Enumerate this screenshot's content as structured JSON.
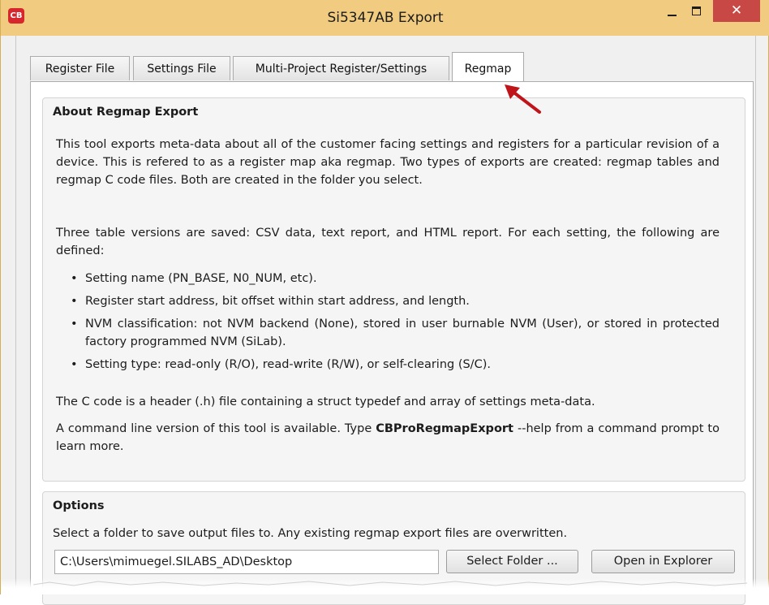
{
  "window": {
    "app_icon_text": "CB",
    "title": "Si5347AB Export",
    "minimize_glyph": "–",
    "maximize_glyph": "□",
    "close_glyph": "✕"
  },
  "tabs": [
    {
      "label": "Register File",
      "active": false
    },
    {
      "label": "Settings File",
      "active": false
    },
    {
      "label": "Multi-Project Register/Settings",
      "active": false
    },
    {
      "label": "Regmap",
      "active": true
    }
  ],
  "about": {
    "title": "About Regmap Export",
    "intro": "This tool exports meta-data about all of the customer facing settings and registers for a particular revision of a device. This is refered to as a register map aka regmap. Two types of exports are created: regmap tables and regmap C code files. Both are created in the folder you select.",
    "tables_intro": "Three table versions are saved: CSV data, text report, and HTML report. For each setting, the following are defined:",
    "bullets": [
      "Setting name (PN_BASE, N0_NUM, etc).",
      "Register start address, bit offset within start address, and length.",
      "NVM classification: not NVM backend (None), stored in user burnable NVM (User), or stored in protected factory programmed NVM (SiLab).",
      "Setting type: read-only (R/O), read-write (R/W), or self-clearing (S/C)."
    ],
    "c_code": "The C code is a header (.h) file containing a struct typedef and array of settings meta-data.",
    "cmd_before": "A command line version of this tool is available. Type",
    "cmd_name": "CBProRegmapExport",
    "cmd_after": "--help from a command prompt to learn more."
  },
  "options": {
    "title": "Options",
    "description": "Select a folder to save output files to. Any existing regmap export files are overwritten.",
    "folder_path": "C:\\Users\\mimuegel.SILABS_AD\\Desktop",
    "select_folder_label": "Select Folder ...",
    "open_explorer_label": "Open in Explorer"
  },
  "colors": {
    "titlebar": "#f1cc80",
    "close_button": "#c84846",
    "annotation_arrow": "#c0141b"
  },
  "icons": {
    "app": "cb-app-icon",
    "annotation": "red-arrow-icon"
  }
}
